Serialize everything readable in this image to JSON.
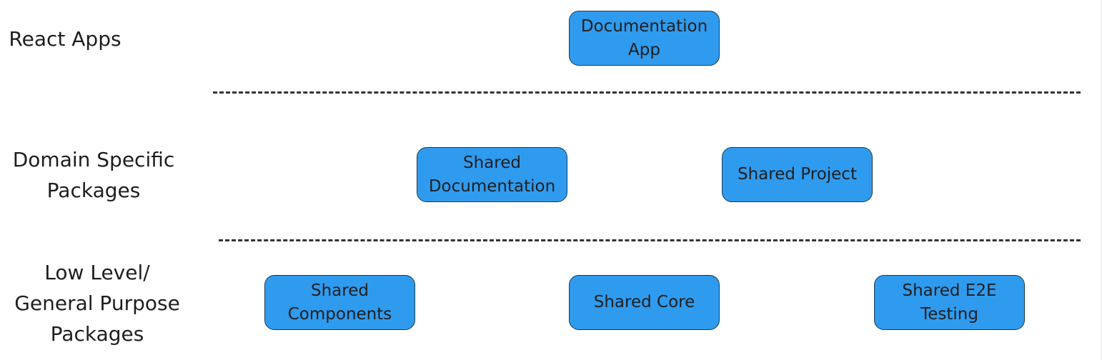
{
  "tiers": [
    {
      "label": "React Apps"
    },
    {
      "label": "Domain Specific Packages"
    },
    {
      "label": "Low Level/ General Purpose Packages"
    }
  ],
  "labels": {
    "react_apps": "React Apps",
    "domain_line1": "Domain Specific",
    "domain_line2": "Packages",
    "low_line1": "Low Level/",
    "low_line2": "General Purpose",
    "low_line3": "Packages"
  },
  "nodes": {
    "documentation_app": {
      "line1": "Documentation",
      "line2": "App"
    },
    "shared_documentation": {
      "line1": "Shared",
      "line2": "Documentation"
    },
    "shared_project": {
      "line1": "Shared Project"
    },
    "shared_components": {
      "line1": "Shared",
      "line2": "Components"
    },
    "shared_core": {
      "line1": "Shared Core"
    },
    "shared_e2e_testing": {
      "line1": "Shared E2E",
      "line2": "Testing"
    }
  },
  "colors": {
    "node_fill": "#2f9bef",
    "node_border": "#1a3a55",
    "divider": "#333333"
  }
}
